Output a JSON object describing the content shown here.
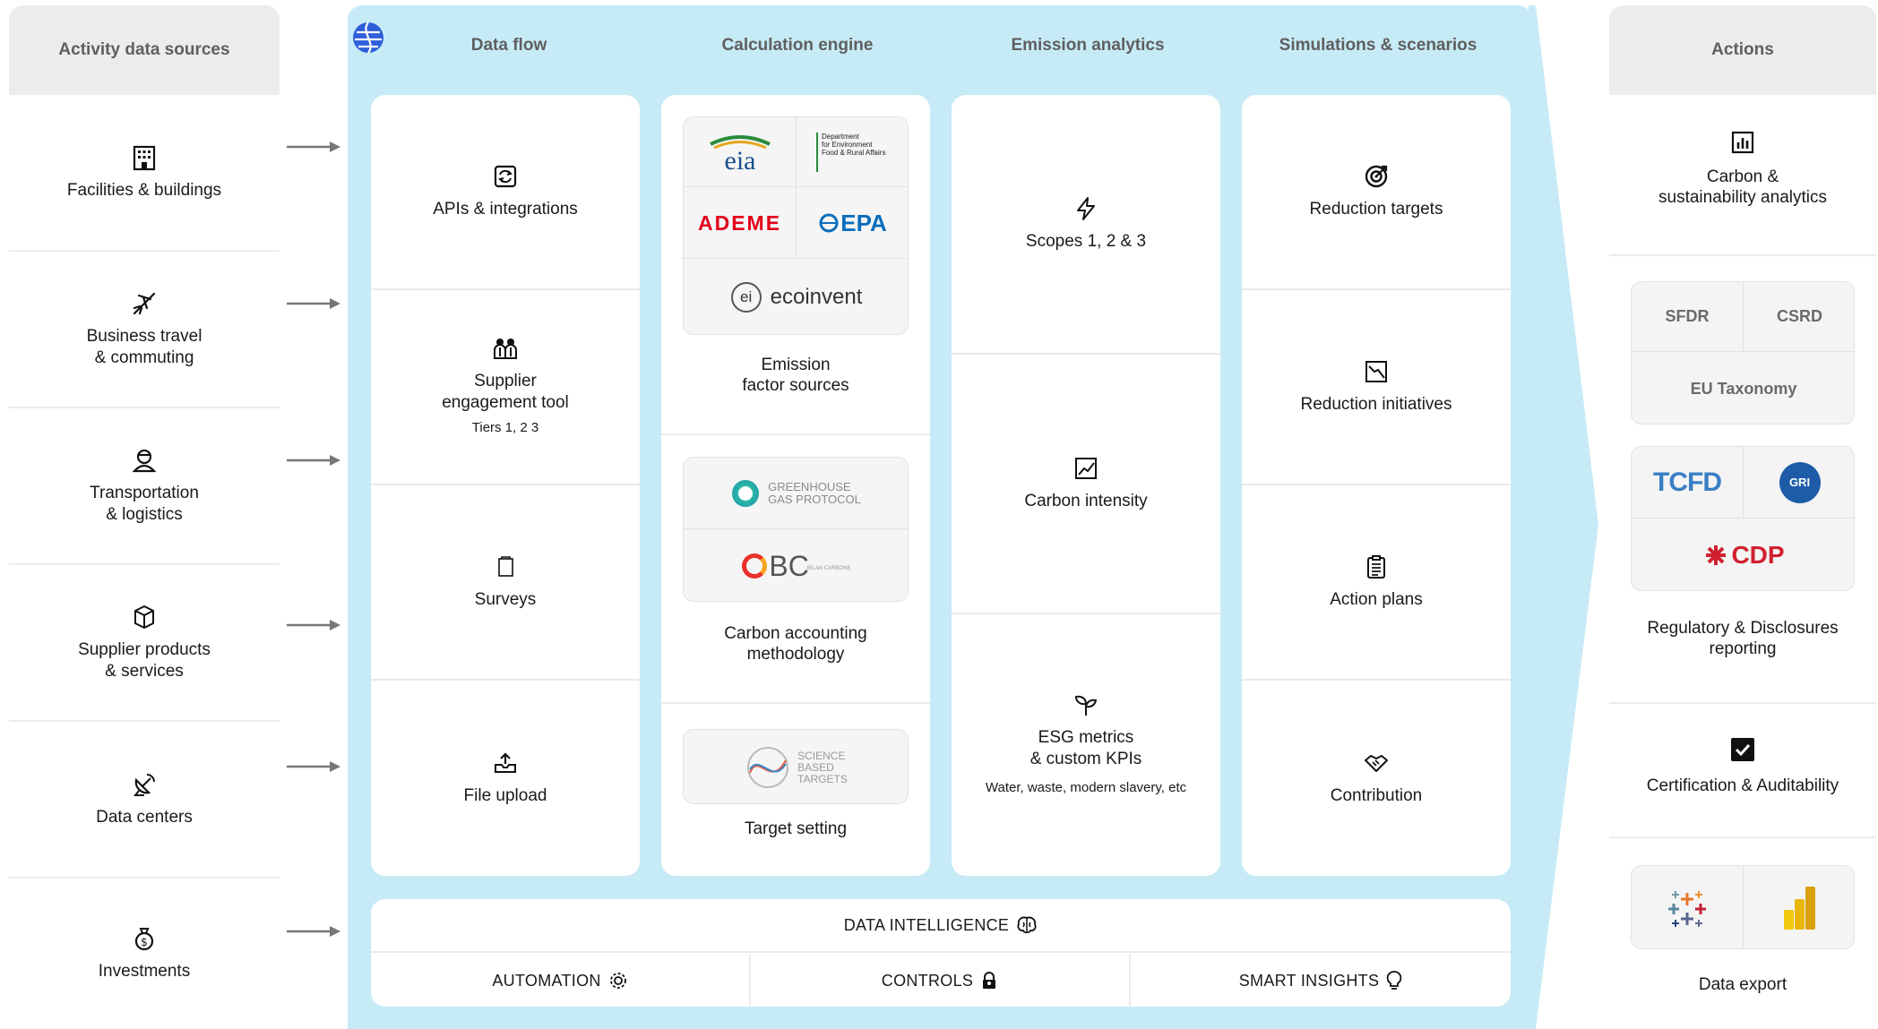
{
  "sources": {
    "title": "Activity data sources",
    "items": [
      {
        "label": "Facilities & buildings",
        "icon": "building-icon"
      },
      {
        "label": "Business travel\n& commuting",
        "icon": "plane-icon"
      },
      {
        "label": "Transportation\n& logistics",
        "icon": "driver-icon"
      },
      {
        "label": "Supplier products\n& services",
        "icon": "package-icon"
      },
      {
        "label": "Data centers",
        "icon": "satellite-dish-icon"
      },
      {
        "label": "Investments",
        "icon": "money-bag-icon"
      }
    ]
  },
  "main": {
    "headers": {
      "data_flow": "Data flow",
      "calc_engine": "Calculation engine",
      "emission_analytics": "Emission analytics",
      "simulations": "Simulations & scenarios"
    },
    "data_flow": [
      {
        "label": "APIs & integrations",
        "icon": "refresh-icon"
      },
      {
        "label": "Supplier\nengagement tool",
        "sub": "Tiers 1, 2 3",
        "icon": "people-icon"
      },
      {
        "label": "Surveys",
        "icon": "clipboard-icon"
      },
      {
        "label": "File upload",
        "icon": "upload-icon"
      }
    ],
    "calc_engine": {
      "emission_factors": {
        "label": "Emission\nfactor sources",
        "logos": {
          "eia": "eia",
          "defra": "Department\nfor Environment\nFood & Rural Affairs",
          "ademe": "ADEME",
          "epa": "EPA",
          "ecoinvent": "ecoinvent",
          "ecoinvent_mark": "ei"
        }
      },
      "methodology": {
        "label": "Carbon accounting\nmethodology",
        "logos": {
          "ghg": "GREENHOUSE\nGAS PROTOCOL",
          "bc": "BC",
          "bc_sub": "BILAN CARBONE"
        }
      },
      "targets": {
        "label": "Target setting",
        "logos": {
          "sbt": "SCIENCE\nBASED\nTARGETS"
        }
      }
    },
    "emission_analytics": [
      {
        "label": "Scopes 1, 2 & 3",
        "icon": "lightning-icon"
      },
      {
        "label": "Carbon intensity",
        "icon": "line-chart-icon"
      },
      {
        "label": "ESG metrics\n& custom KPIs",
        "sub": "Water, waste, modern slavery, etc",
        "icon": "sprout-icon"
      }
    ],
    "simulations": [
      {
        "label": "Reduction targets",
        "icon": "target-icon"
      },
      {
        "label": "Reduction initiatives",
        "icon": "trend-down-icon"
      },
      {
        "label": "Action plans",
        "icon": "checklist-icon"
      },
      {
        "label": "Contribution",
        "icon": "handshake-icon"
      }
    ],
    "data_intelligence": {
      "title": "DATA INTELLIGENCE",
      "items": [
        "AUTOMATION",
        "CONTROLS",
        "SMART INSIGHTS"
      ]
    }
  },
  "actions": {
    "title": "Actions",
    "analytics": "Carbon &\nsustainability analytics",
    "frameworks": [
      "SFDR",
      "CSRD",
      "EU Taxonomy"
    ],
    "logos": {
      "tcfd": "TCFD",
      "gri": "GRI",
      "cdp": "CDP"
    },
    "reporting": "Regulatory & Disclosures\nreporting",
    "certification": "Certification & Auditability",
    "export": "Data export"
  },
  "colors": {
    "panel_blue": "#c7ebf6",
    "ademe_red": "#e2001a",
    "epa_blue": "#0a6ebd",
    "tcfd_blue": "#3a7fc4",
    "gri_blue": "#1e5ca8",
    "cdp_red": "#d0202e"
  }
}
